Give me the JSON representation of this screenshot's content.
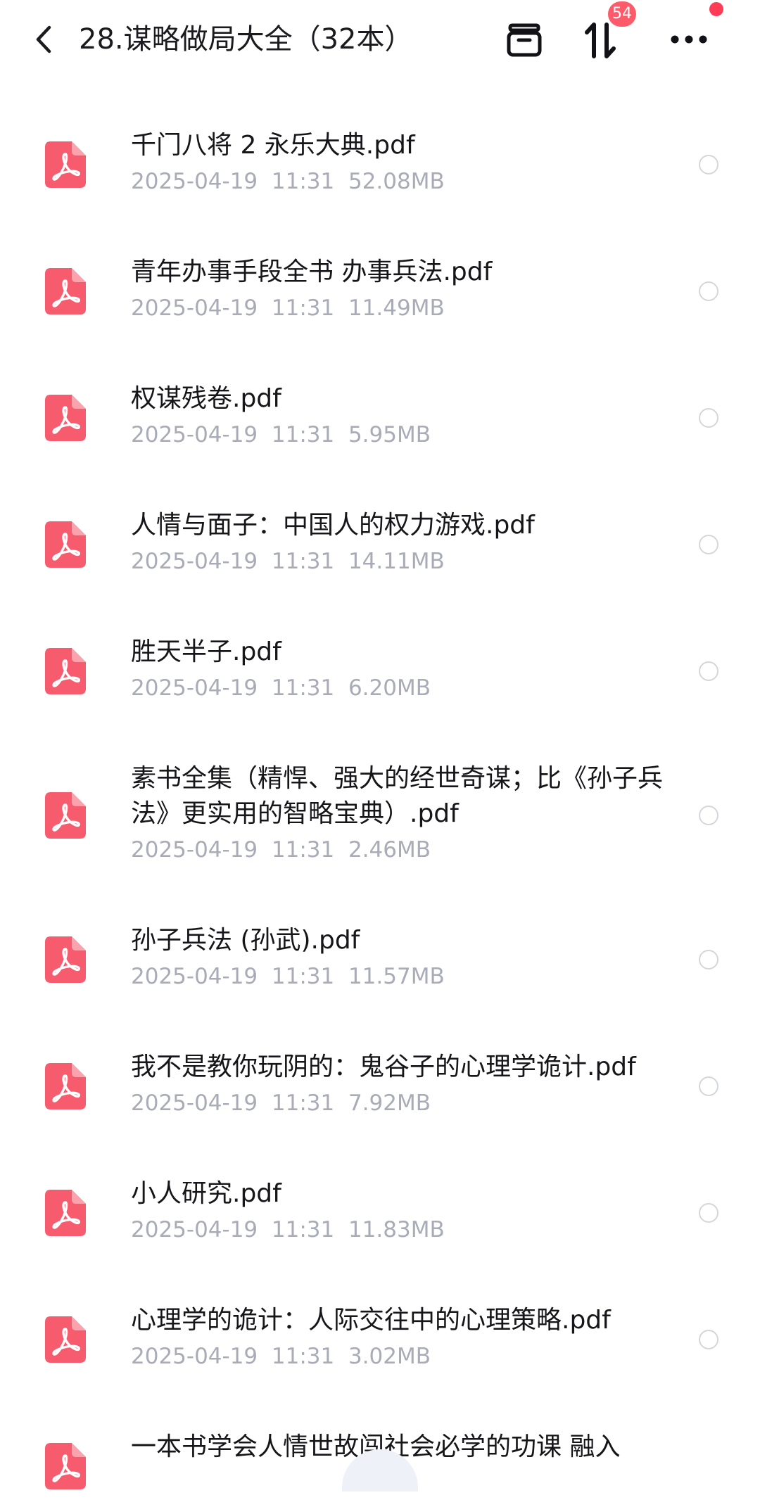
{
  "header": {
    "title": "28.谋略做局大全（32本）",
    "transfer_badge": "54",
    "icons": {
      "back": "chevron-left-icon",
      "archive": "archive-box-icon",
      "transfer": "up-down-arrows-icon",
      "more": "more-dots-icon"
    }
  },
  "colors": {
    "pdf_icon": "#f75c6e",
    "badge": "#ff5a6a",
    "meta_text": "#a9acb6"
  },
  "files": [
    {
      "name": "千门八将 2 永乐大典.pdf",
      "date": "2025-04-19",
      "time": "11:31",
      "size": "52.08MB"
    },
    {
      "name": "青年办事手段全书 办事兵法.pdf",
      "date": "2025-04-19",
      "time": "11:31",
      "size": "11.49MB"
    },
    {
      "name": "权谋残卷.pdf",
      "date": "2025-04-19",
      "time": "11:31",
      "size": "5.95MB"
    },
    {
      "name": "人情与面子：中国人的权力游戏.pdf",
      "date": "2025-04-19",
      "time": "11:31",
      "size": "14.11MB"
    },
    {
      "name": "胜天半子.pdf",
      "date": "2025-04-19",
      "time": "11:31",
      "size": "6.20MB"
    },
    {
      "name": "素书全集（精悍、强大的经世奇谋；比《孙子兵法》更实用的智略宝典）.pdf",
      "date": "2025-04-19",
      "time": "11:31",
      "size": "2.46MB"
    },
    {
      "name": "孙子兵法 (孙武).pdf",
      "date": "2025-04-19",
      "time": "11:31",
      "size": "11.57MB"
    },
    {
      "name": "我不是教你玩阴的：鬼谷子的心理学诡计.pdf",
      "date": "2025-04-19",
      "time": "11:31",
      "size": "7.92MB"
    },
    {
      "name": "小人研究.pdf",
      "date": "2025-04-19",
      "time": "11:31",
      "size": "11.83MB"
    },
    {
      "name": "心理学的诡计：人际交往中的心理策略.pdf",
      "date": "2025-04-19",
      "time": "11:31",
      "size": "3.02MB"
    },
    {
      "name": "一本书学会人情世故闯社会必学的功课 融入",
      "date": "",
      "time": "",
      "size": ""
    }
  ]
}
